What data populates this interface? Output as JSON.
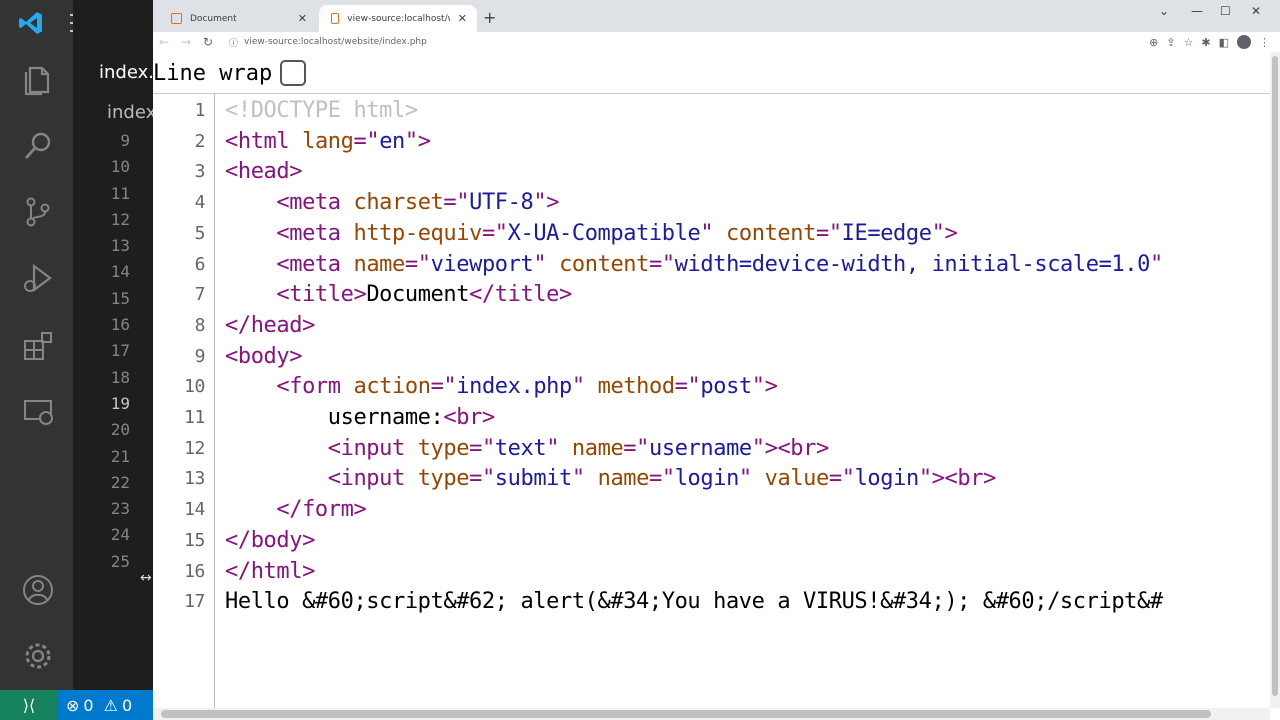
{
  "vscode": {
    "tab_label": "index.php",
    "breadcrumb": "index.php",
    "line_numbers": [
      "9",
      "10",
      "11",
      "12",
      "13",
      "14",
      "15",
      "16",
      "17",
      "18",
      "19",
      "20",
      "21",
      "22",
      "23",
      "24",
      "25"
    ],
    "active_line": "19",
    "status": {
      "errors": "0",
      "warnings": "0"
    }
  },
  "browser": {
    "tabs": [
      {
        "title": "Document"
      },
      {
        "title": "view-source:localhost/website/in"
      }
    ],
    "url": "view-source:localhost/website/index.php",
    "line_wrap_label": "Line wrap",
    "source_lines": [
      {
        "n": "1",
        "html": "<span class='c'>&lt;!DOCTYPE html&gt;</span>"
      },
      {
        "n": "2",
        "html": "<span class='t'>&lt;html</span> <span class='a'>lang</span><span class='t'>=\"</span><span class='v'>en</span><span class='t'>\"&gt;</span>"
      },
      {
        "n": "3",
        "html": "<span class='t'>&lt;head&gt;</span>"
      },
      {
        "n": "4",
        "html": "    <span class='t'>&lt;meta</span> <span class='a'>charset</span><span class='t'>=\"</span><span class='v'>UTF-8</span><span class='t'>\"&gt;</span>"
      },
      {
        "n": "5",
        "html": "    <span class='t'>&lt;meta</span> <span class='a'>http-equiv</span><span class='t'>=\"</span><span class='v'>X-UA-Compatible</span><span class='t'>\"</span> <span class='a'>content</span><span class='t'>=\"</span><span class='v'>IE=edge</span><span class='t'>\"&gt;</span>"
      },
      {
        "n": "6",
        "html": "    <span class='t'>&lt;meta</span> <span class='a'>name</span><span class='t'>=\"</span><span class='v'>viewport</span><span class='t'>\"</span> <span class='a'>content</span><span class='t'>=\"</span><span class='v'>width=device-width, initial-scale=1.0</span><span class='t'>\"</span>"
      },
      {
        "n": "7",
        "html": "    <span class='t'>&lt;title&gt;</span>Document<span class='t'>&lt;/title&gt;</span>"
      },
      {
        "n": "8",
        "html": "<span class='t'>&lt;/head&gt;</span>"
      },
      {
        "n": "9",
        "html": "<span class='t'>&lt;body&gt;</span>"
      },
      {
        "n": "10",
        "html": "    <span class='t'>&lt;form</span> <span class='a'>action</span><span class='t'>=\"</span><span class='v'>index.php</span><span class='t'>\"</span> <span class='a'>method</span><span class='t'>=\"</span><span class='v'>post</span><span class='t'>\"&gt;</span>"
      },
      {
        "n": "11",
        "html": "        username:<span class='t'>&lt;br&gt;</span>"
      },
      {
        "n": "12",
        "html": "        <span class='t'>&lt;input</span> <span class='a'>type</span><span class='t'>=\"</span><span class='v'>text</span><span class='t'>\"</span> <span class='a'>name</span><span class='t'>=\"</span><span class='v'>username</span><span class='t'>\"&gt;&lt;br&gt;</span>"
      },
      {
        "n": "13",
        "html": "        <span class='t'>&lt;input</span> <span class='a'>type</span><span class='t'>=\"</span><span class='v'>submit</span><span class='t'>\"</span> <span class='a'>name</span><span class='t'>=\"</span><span class='v'>login</span><span class='t'>\"</span> <span class='a'>value</span><span class='t'>=\"</span><span class='v'>login</span><span class='t'>\"&gt;&lt;br&gt;</span>"
      },
      {
        "n": "14",
        "html": "    <span class='t'>&lt;/form&gt;</span>"
      },
      {
        "n": "15",
        "html": "<span class='t'>&lt;/body&gt;</span>"
      },
      {
        "n": "16",
        "html": "<span class='t'>&lt;/html&gt;</span>"
      },
      {
        "n": "17",
        "html": "Hello &amp;#60;script&amp;#62; alert(&amp;#34;You have a VIRUS!&amp;#34;); &amp;#60;/script&amp;#"
      }
    ]
  }
}
